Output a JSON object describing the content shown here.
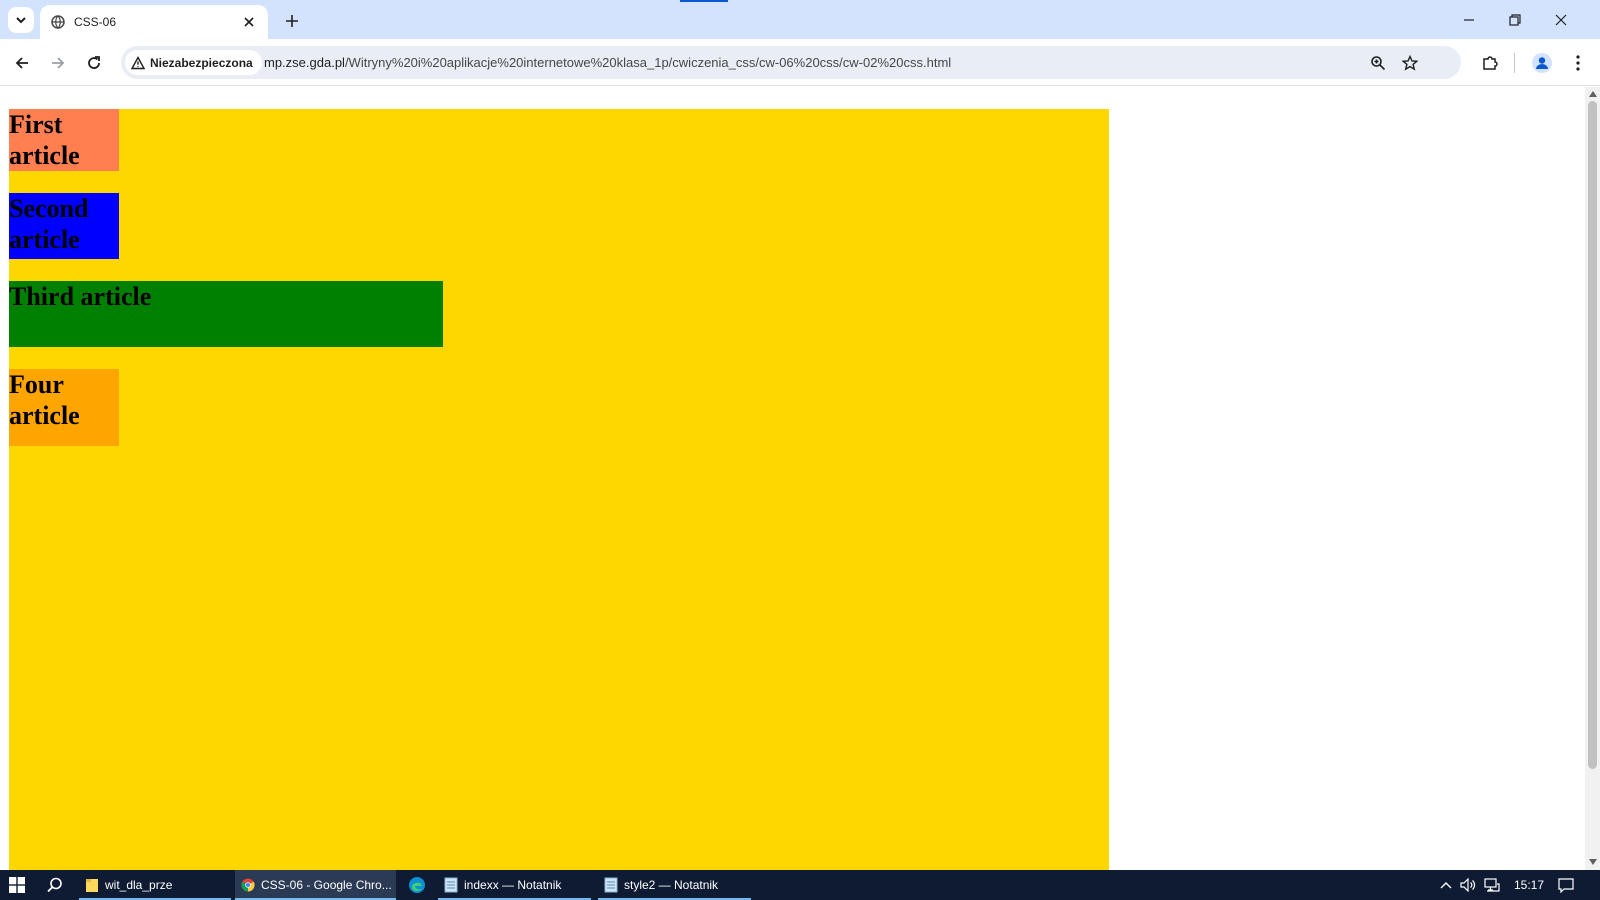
{
  "browser": {
    "tab": {
      "title": "CSS-06"
    },
    "address": {
      "security_label": "Niezabezpieczona",
      "url_host": "mp.zse.gda.pl",
      "url_path": "/Witryny%20i%20aplikacje%20internetowe%20klasa_1p/cwiczenia_css/cw-06%20css/cw-02%20css.html"
    }
  },
  "page": {
    "articles": [
      {
        "label": "First article",
        "color": "#ff7f50"
      },
      {
        "label": "Second article",
        "color": "#0000ff"
      },
      {
        "label": "Third article",
        "color": "#008000"
      },
      {
        "label": "Four article",
        "color": "#ffa500"
      }
    ],
    "main_color": "#ffd700"
  },
  "taskbar": {
    "items": [
      {
        "label": "wit_dla_prze",
        "icon": "folder-icon"
      },
      {
        "label": "CSS-06 - Google Chro...",
        "icon": "chrome-icon"
      },
      {
        "label": "",
        "icon": "edge-icon"
      },
      {
        "label": "indexx — Notatnik",
        "icon": "notepad-icon"
      },
      {
        "label": "style2 — Notatnik",
        "icon": "notepad-icon"
      }
    ],
    "clock": "15:17"
  }
}
